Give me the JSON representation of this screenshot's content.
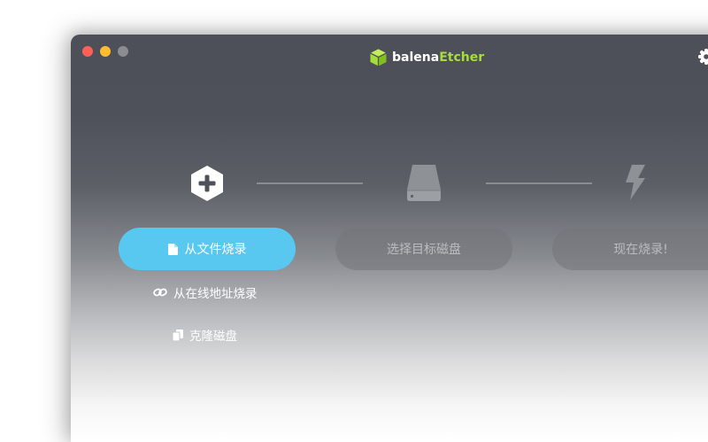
{
  "app": {
    "brand_prefix": "balena",
    "brand_suffix": "Etcher",
    "accent_color": "#58c8f0",
    "brand_color": "#a5de37"
  },
  "steps": {
    "source": {
      "icon": "plus-hexagon-icon",
      "button_label": "从文件烧录",
      "button_icon": "file-icon"
    },
    "target": {
      "icon": "drive-icon",
      "button_label": "选择目标磁盘"
    },
    "flash": {
      "icon": "lightning-icon",
      "button_label": "现在烧录!"
    }
  },
  "alt_sources": {
    "url_label": "从在线地址烧录",
    "url_icon": "link-icon",
    "clone_label": "克隆磁盘",
    "clone_icon": "copy-icon"
  }
}
